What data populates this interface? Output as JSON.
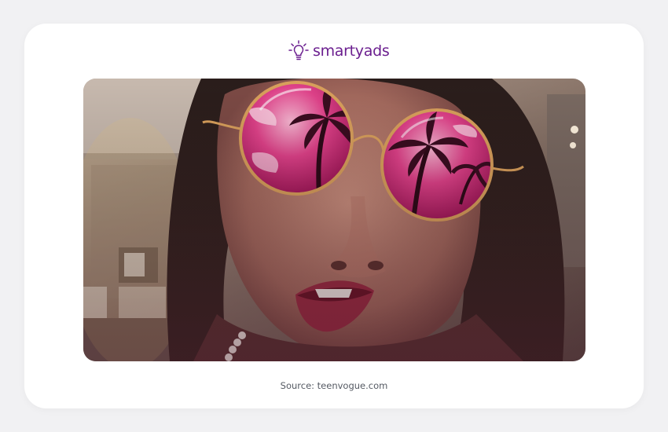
{
  "brand": {
    "name": "smartyads",
    "color": "#6b1f8f",
    "icon": "lightbulb-icon"
  },
  "image": {
    "subject": "photo-of-person-with-pink-sunglasses-filter",
    "lens_color": "#e0428a",
    "frame_color": "#d9a05c"
  },
  "caption": {
    "text": "Source: teenvogue.com"
  }
}
